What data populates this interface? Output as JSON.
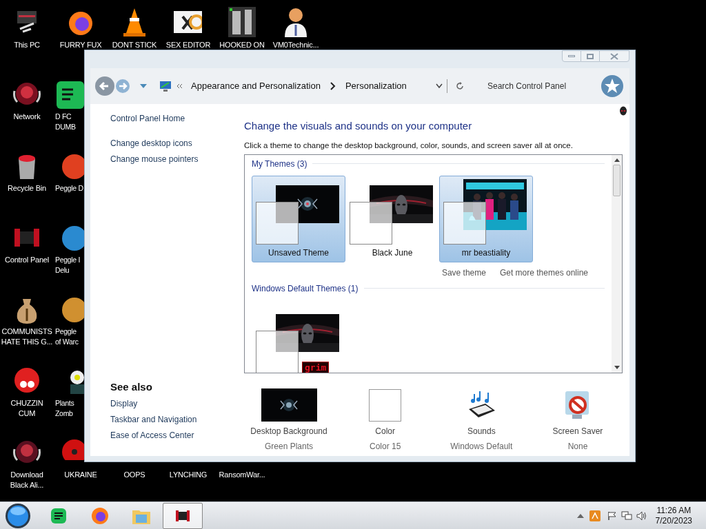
{
  "desktop_icons": [
    {
      "label": "This PC"
    },
    {
      "label": "FURRY FUX"
    },
    {
      "label": "DONT STICK"
    },
    {
      "label": "SEX EDITOR"
    },
    {
      "label": "HOOKED ON"
    },
    {
      "label": "VM0Technic..."
    },
    {
      "label": "Network"
    },
    {
      "label": "D FC\nDUMB"
    },
    {
      "label": "Recycle Bin"
    },
    {
      "label": "Peggle D"
    },
    {
      "label": "Control Panel"
    },
    {
      "label": "Peggle I\nDelu"
    },
    {
      "label": "COMMUNISTS\nHATE THIS G..."
    },
    {
      "label": "Peggle\nof Warc"
    },
    {
      "label": "CHUZZIN\nCUM"
    },
    {
      "label": "Plants\nZomb"
    },
    {
      "label": "Download\nBlack Ali..."
    },
    {
      "label": "UKRAINE"
    },
    {
      "label": "OOPS"
    },
    {
      "label": "LYNCHING"
    },
    {
      "label": "RansomWar..."
    }
  ],
  "window": {
    "breadcrumb": [
      "Appearance and Personalization",
      "Personalization"
    ],
    "search": {
      "placeholder": "Search Control Panel"
    },
    "sidebar": {
      "links": [
        "Control Panel Home",
        "Change desktop icons",
        "Change mouse pointers"
      ],
      "see_also": {
        "title": "See also",
        "links": [
          "Display",
          "Taskbar and Navigation",
          "Ease of Access Center"
        ]
      }
    },
    "heading": "Change the visuals and sounds on your computer",
    "description": "Click a theme to change the desktop background, color, sounds, and screen saver all at once.",
    "groups": [
      {
        "title": "My Themes (3)",
        "themes": [
          {
            "name": "Unsaved Theme",
            "selected": true
          },
          {
            "name": "Black June",
            "selected": false
          },
          {
            "name": "mr beastiality",
            "selected": true
          }
        ],
        "links": [
          "Save theme",
          "Get more themes online"
        ]
      },
      {
        "title": "Windows Default Themes (1)",
        "themes": [
          {
            "badge": "grim",
            "selected": false
          }
        ]
      }
    ],
    "settings": [
      {
        "title": "Desktop Background",
        "value": "Green Plants"
      },
      {
        "title": "Color",
        "value": "Color 15"
      },
      {
        "title": "Sounds",
        "value": "Windows Default"
      },
      {
        "title": "Screen Saver",
        "value": "None"
      }
    ]
  },
  "taskbar": {
    "apps": [
      {
        "selected": false
      },
      {
        "selected": false
      },
      {
        "selected": false
      },
      {
        "selected": true
      }
    ],
    "time": "11:26 AM",
    "date": "7/20/2023"
  }
}
